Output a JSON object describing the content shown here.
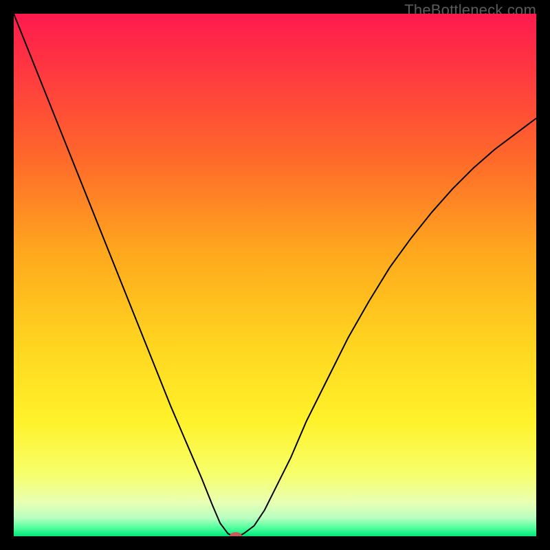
{
  "watermark": "TheBottleneck.com",
  "chart_data": {
    "type": "line",
    "title": "",
    "xlabel": "",
    "ylabel": "",
    "xlim": [
      0,
      100
    ],
    "ylim": [
      0,
      100
    ],
    "background_gradient": {
      "stops": [
        {
          "offset": 0.0,
          "color": "#ff1a4e"
        },
        {
          "offset": 0.12,
          "color": "#ff3b3f"
        },
        {
          "offset": 0.28,
          "color": "#ff6a2a"
        },
        {
          "offset": 0.45,
          "color": "#ffa61e"
        },
        {
          "offset": 0.62,
          "color": "#ffd21f"
        },
        {
          "offset": 0.78,
          "color": "#fff22a"
        },
        {
          "offset": 0.88,
          "color": "#f7ff6a"
        },
        {
          "offset": 0.935,
          "color": "#e9ffb3"
        },
        {
          "offset": 0.965,
          "color": "#b8ffc0"
        },
        {
          "offset": 0.985,
          "color": "#4aff9b"
        },
        {
          "offset": 1.0,
          "color": "#00e57a"
        }
      ]
    },
    "series": [
      {
        "name": "bottleneck-curve",
        "stroke": "#000000",
        "stroke_width": 2,
        "x": [
          0,
          3,
          6,
          9,
          12,
          15,
          18,
          21,
          24,
          27,
          30,
          33,
          36,
          38,
          39.5,
          41,
          42,
          43,
          44,
          46,
          48,
          50,
          53,
          56,
          60,
          64,
          68,
          72,
          76,
          80,
          84,
          88,
          92,
          96,
          100
        ],
        "y": [
          100,
          92.5,
          85,
          77.5,
          70,
          62.5,
          55,
          47.5,
          40,
          32.5,
          25,
          18,
          11,
          6,
          2.5,
          0.5,
          0,
          0,
          0.5,
          2,
          5,
          9,
          15,
          22,
          30,
          38,
          45,
          51.5,
          57,
          62,
          66.5,
          70.5,
          74,
          77,
          80
        ]
      }
    ],
    "marker": {
      "name": "min-point-marker",
      "x": 42.5,
      "y": 0,
      "rx": 9,
      "ry": 6,
      "fill": "#c95a5a"
    }
  }
}
